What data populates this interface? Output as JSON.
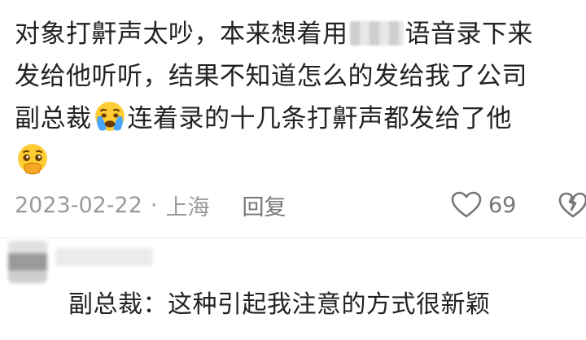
{
  "comment": {
    "line1_a": "对象打鼾声太吵，本来想着用",
    "line1_b": "语音录下来",
    "line2": "发给他听听，结果不知道怎么的发给我了公司",
    "line3_a": "副总裁",
    "line3_b": "连着录的十几条打鼾声都发给了他",
    "emoji_1": "crying-face-emoji",
    "emoji_2": "pleading-face-emoji"
  },
  "meta": {
    "date": "2023-02-22",
    "separator": "·",
    "location": "上海",
    "reply_label": "回复",
    "like_count": "69"
  },
  "reply": {
    "text": "副总裁：这种引起我注意的方式很新颖"
  },
  "colors": {
    "text": "#222222",
    "meta": "#9a9a9a",
    "emoji_yellow": "#ffcc33"
  }
}
